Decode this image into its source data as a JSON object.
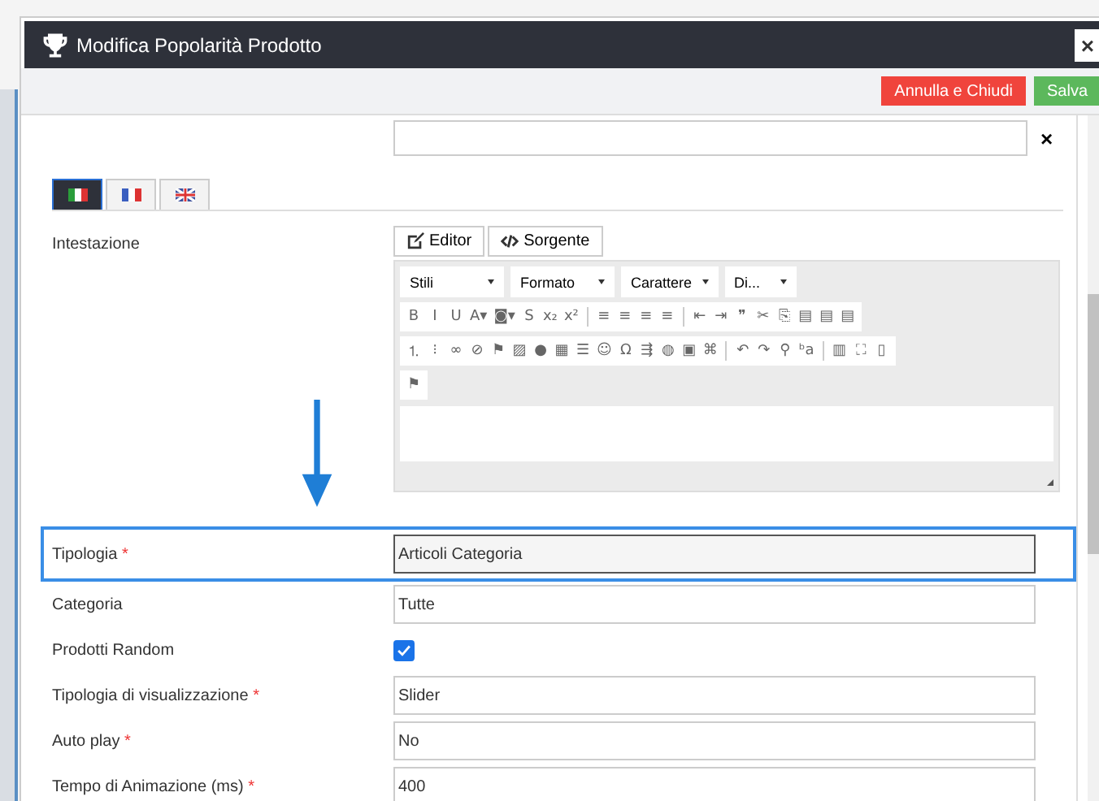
{
  "window": {
    "title": "Modifica Popolarità Prodotto",
    "close": "×"
  },
  "actions": [
    {
      "label": "Annulla e Chiudi",
      "kind": "danger"
    },
    {
      "label": "Salva",
      "kind": "success"
    }
  ],
  "top_field": {
    "clear": "×"
  },
  "language_tabs": [
    {
      "kind": "it",
      "selected": true
    },
    {
      "kind": "fr",
      "selected": false
    },
    {
      "kind": "gb",
      "selected": false
    }
  ],
  "editor": {
    "label": "Intestazione",
    "modes": [
      {
        "label": "Editor",
        "kind": "editor"
      },
      {
        "label": "Sorgente",
        "kind": "source"
      }
    ],
    "dropdowns": [
      "Stili",
      "Formato",
      "Carattere",
      "Di..."
    ],
    "toolbar_rows": [
      [
        [
          "B",
          "I",
          "U",
          "A▾",
          "◙▾",
          "S",
          "x₂",
          "x²"
        ],
        [
          "≡",
          "≡",
          "≡",
          "≡"
        ],
        [
          "⇤",
          "⇥",
          "❞",
          "✂",
          "⎘",
          "▤",
          "▤",
          "▤"
        ]
      ],
      [
        [
          "⒈",
          "⁝",
          "∞",
          "⊘",
          "⚑",
          "▨",
          "●",
          "▦",
          "☰",
          "☺",
          "Ω",
          "⇶",
          "◍",
          "▣",
          "⌘"
        ],
        [
          "↶",
          "↷",
          "⚲",
          "ᵇa"
        ],
        [
          "▥",
          "⛶",
          "▯"
        ]
      ],
      [
        [
          "⚑"
        ]
      ]
    ]
  },
  "fields": [
    {
      "label": "Tipologia",
      "required_mark": "*",
      "kind": "select",
      "value": "Articoli Categoria",
      "highlighted": true
    },
    {
      "label": "Categoria",
      "kind": "select",
      "value": "Tutte",
      "highlighted": false
    },
    {
      "label": "Prodotti Random",
      "kind": "checkbox",
      "checked": true,
      "highlighted": false
    },
    {
      "label": "Tipologia di visualizzazione",
      "required_mark": "*",
      "kind": "select",
      "value": "Slider",
      "highlighted": false
    },
    {
      "label": "Auto play",
      "required_mark": "*",
      "kind": "select",
      "value": "No",
      "highlighted": false
    },
    {
      "label": "Tempo di Animazione (ms)",
      "required_mark": "*",
      "kind": "text",
      "value": "400",
      "highlighted": false
    }
  ]
}
